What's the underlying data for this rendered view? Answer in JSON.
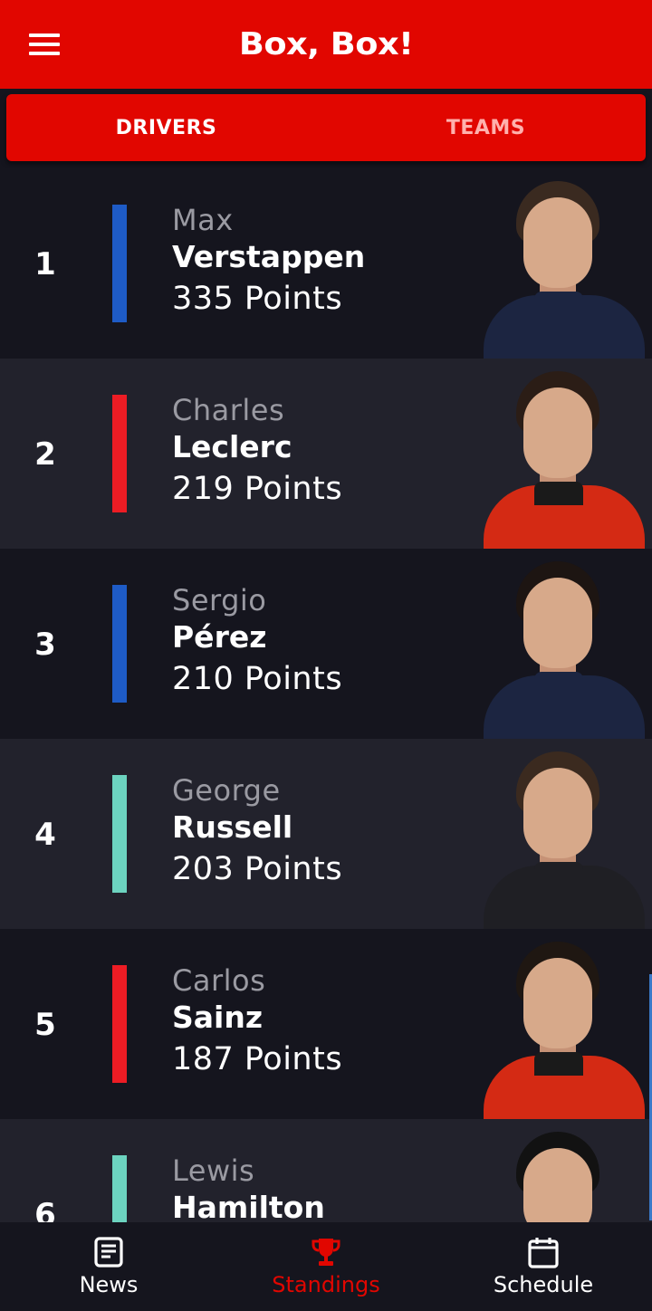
{
  "app": {
    "title": "Box, Box!"
  },
  "tabs": [
    {
      "label": "DRIVERS",
      "active": true
    },
    {
      "label": "TEAMS",
      "active": false
    }
  ],
  "drivers": [
    {
      "position": "1",
      "first_name": "Max",
      "last_name": "Verstappen",
      "points": "335 Points",
      "team_color": "#1e5bc6",
      "suit_color": "#1c2541",
      "collar_color": "#1c2541",
      "hair_color": "#3a2a20"
    },
    {
      "position": "2",
      "first_name": "Charles",
      "last_name": "Leclerc",
      "points": "219 Points",
      "team_color": "#ed1c24",
      "suit_color": "#d42a14",
      "collar_color": "#1a1a1a",
      "hair_color": "#2b1d16"
    },
    {
      "position": "3",
      "first_name": "Sergio",
      "last_name": "Pérez",
      "points": "210 Points",
      "team_color": "#1e5bc6",
      "suit_color": "#1c2541",
      "collar_color": "#1c2541",
      "hair_color": "#1d1512"
    },
    {
      "position": "4",
      "first_name": "George",
      "last_name": "Russell",
      "points": "203 Points",
      "team_color": "#6cd3bf",
      "suit_color": "#1f1f24",
      "collar_color": "#1f1f24",
      "hair_color": "#3b2a1f"
    },
    {
      "position": "5",
      "first_name": "Carlos",
      "last_name": "Sainz",
      "points": "187 Points",
      "team_color": "#ed1c24",
      "suit_color": "#d42a14",
      "collar_color": "#1a1a1a",
      "hair_color": "#1f1712"
    },
    {
      "position": "6",
      "first_name": "Lewis",
      "last_name": "Hamilton",
      "points": "",
      "team_color": "#6cd3bf",
      "suit_color": "#1f1f24",
      "collar_color": "#1f1f24",
      "hair_color": "#121212"
    }
  ],
  "bottom_nav": [
    {
      "label": "News",
      "icon": "news-icon",
      "active": false
    },
    {
      "label": "Standings",
      "icon": "trophy-icon",
      "active": true
    },
    {
      "label": "Schedule",
      "icon": "calendar-icon",
      "active": false
    }
  ],
  "colors": {
    "brand_red": "#e10600",
    "background": "#15151e",
    "row_alt": "#22222c"
  }
}
